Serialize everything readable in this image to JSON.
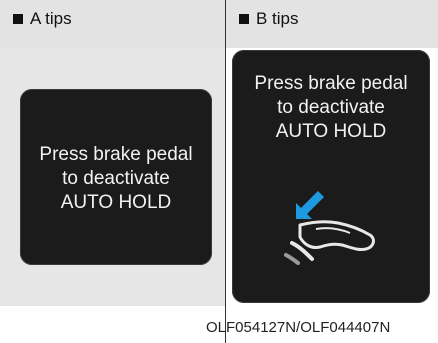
{
  "panel_a": {
    "header_label": "A tips",
    "display_lines": [
      "Press brake pedal",
      "to deactivate",
      "AUTO HOLD"
    ]
  },
  "panel_b": {
    "header_label": "B tips",
    "display_lines": [
      "Press brake pedal",
      "to deactivate",
      "AUTO HOLD"
    ],
    "icon": "foot-on-pedal-icon",
    "arrow_color": "#1e9be0"
  },
  "caption": "OLF054127N/OLF044407N"
}
